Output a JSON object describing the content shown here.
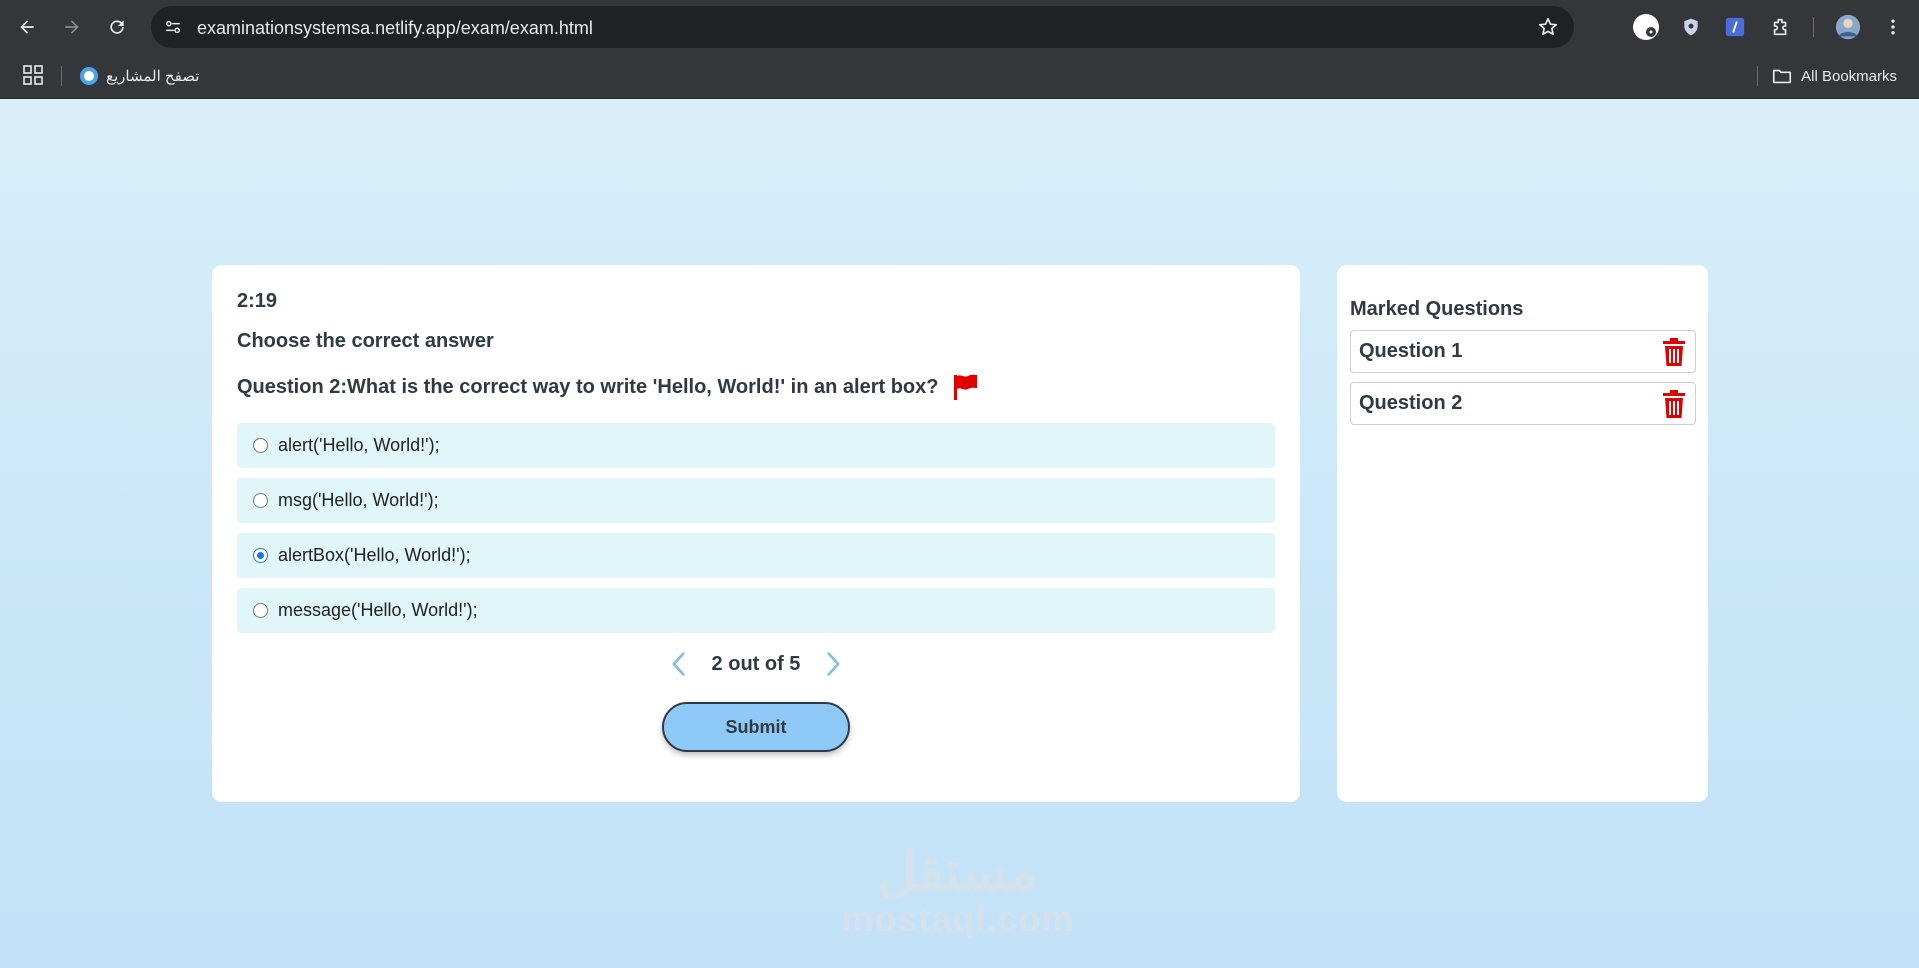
{
  "browser": {
    "url": "examinationsystemsa.netlify.app/exam/exam.html",
    "bookmark_label": "تصفح المشاريع",
    "all_bookmarks_label": "All Bookmarks",
    "icons": [
      "back-arrow-icon",
      "forward-arrow-icon",
      "reload-icon",
      "site-info-icon",
      "bookmark-star-icon",
      "profile-avatar-icon",
      "menu-dots-icon"
    ]
  },
  "exam": {
    "timer": "2:19",
    "instruction": "Choose the correct answer",
    "question": "Question 2:What is the correct way to write 'Hello, World!' in an alert box?",
    "options": [
      {
        "label": "alert('Hello, World!');",
        "checked": false
      },
      {
        "label": "msg('Hello, World!');",
        "checked": false
      },
      {
        "label": "alertBox('Hello, World!');",
        "checked": true
      },
      {
        "label": "message('Hello, World!');",
        "checked": false
      }
    ],
    "pager": "2 out of 5",
    "submit_label": "Submit"
  },
  "marked": {
    "title": "Marked Questions",
    "items": [
      "Question 1",
      "Question 2"
    ]
  },
  "watermark": {
    "arabic": "مستقل",
    "latin": "mostaql.com"
  },
  "colors": {
    "flag": "#e00000",
    "trash": "#e00000",
    "submit_bg": "#8ec9f7",
    "option_bg": "#e0f6f9",
    "chevron": "#7fbfe8"
  }
}
